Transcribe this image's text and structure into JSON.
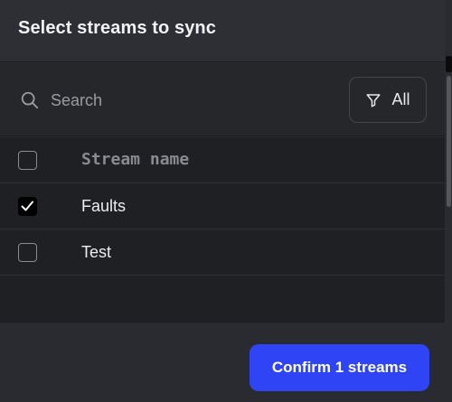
{
  "dialog": {
    "title": "Select streams to sync"
  },
  "search": {
    "placeholder": "Search",
    "value": "",
    "icon": "search-icon"
  },
  "filter": {
    "label": "All",
    "icon": "filter-icon"
  },
  "table": {
    "column_header": "Stream name",
    "header_checked": false,
    "rows": [
      {
        "name": "Faults",
        "checked": true
      },
      {
        "name": "Test",
        "checked": false
      }
    ]
  },
  "footer": {
    "confirm_label": "Confirm 1 streams"
  },
  "colors": {
    "accent": "#2f45f5",
    "background": "#2a2b30",
    "table_background": "#1f2024"
  }
}
